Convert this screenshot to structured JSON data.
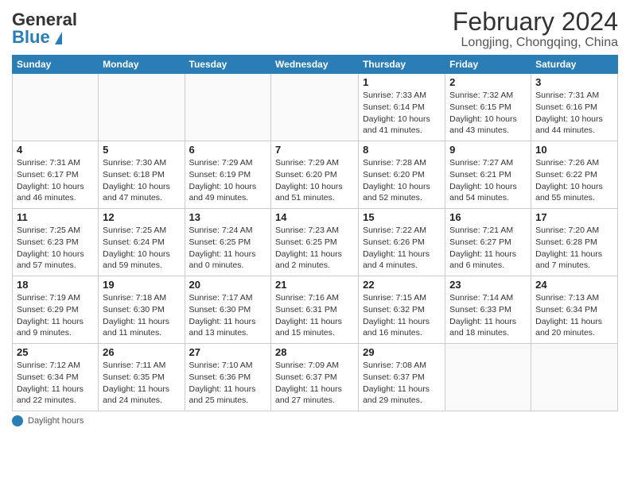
{
  "header": {
    "logo_text_general": "General",
    "logo_text_blue": "Blue",
    "month_title": "February 2024",
    "location": "Longjing, Chongqing, China"
  },
  "days_of_week": [
    "Sunday",
    "Monday",
    "Tuesday",
    "Wednesday",
    "Thursday",
    "Friday",
    "Saturday"
  ],
  "footer": {
    "daylight_label": "Daylight hours"
  },
  "weeks": [
    [
      {
        "day": "",
        "info": ""
      },
      {
        "day": "",
        "info": ""
      },
      {
        "day": "",
        "info": ""
      },
      {
        "day": "",
        "info": ""
      },
      {
        "day": "1",
        "info": "Sunrise: 7:33 AM\nSunset: 6:14 PM\nDaylight: 10 hours\nand 41 minutes."
      },
      {
        "day": "2",
        "info": "Sunrise: 7:32 AM\nSunset: 6:15 PM\nDaylight: 10 hours\nand 43 minutes."
      },
      {
        "day": "3",
        "info": "Sunrise: 7:31 AM\nSunset: 6:16 PM\nDaylight: 10 hours\nand 44 minutes."
      }
    ],
    [
      {
        "day": "4",
        "info": "Sunrise: 7:31 AM\nSunset: 6:17 PM\nDaylight: 10 hours\nand 46 minutes."
      },
      {
        "day": "5",
        "info": "Sunrise: 7:30 AM\nSunset: 6:18 PM\nDaylight: 10 hours\nand 47 minutes."
      },
      {
        "day": "6",
        "info": "Sunrise: 7:29 AM\nSunset: 6:19 PM\nDaylight: 10 hours\nand 49 minutes."
      },
      {
        "day": "7",
        "info": "Sunrise: 7:29 AM\nSunset: 6:20 PM\nDaylight: 10 hours\nand 51 minutes."
      },
      {
        "day": "8",
        "info": "Sunrise: 7:28 AM\nSunset: 6:20 PM\nDaylight: 10 hours\nand 52 minutes."
      },
      {
        "day": "9",
        "info": "Sunrise: 7:27 AM\nSunset: 6:21 PM\nDaylight: 10 hours\nand 54 minutes."
      },
      {
        "day": "10",
        "info": "Sunrise: 7:26 AM\nSunset: 6:22 PM\nDaylight: 10 hours\nand 55 minutes."
      }
    ],
    [
      {
        "day": "11",
        "info": "Sunrise: 7:25 AM\nSunset: 6:23 PM\nDaylight: 10 hours\nand 57 minutes."
      },
      {
        "day": "12",
        "info": "Sunrise: 7:25 AM\nSunset: 6:24 PM\nDaylight: 10 hours\nand 59 minutes."
      },
      {
        "day": "13",
        "info": "Sunrise: 7:24 AM\nSunset: 6:25 PM\nDaylight: 11 hours\nand 0 minutes."
      },
      {
        "day": "14",
        "info": "Sunrise: 7:23 AM\nSunset: 6:25 PM\nDaylight: 11 hours\nand 2 minutes."
      },
      {
        "day": "15",
        "info": "Sunrise: 7:22 AM\nSunset: 6:26 PM\nDaylight: 11 hours\nand 4 minutes."
      },
      {
        "day": "16",
        "info": "Sunrise: 7:21 AM\nSunset: 6:27 PM\nDaylight: 11 hours\nand 6 minutes."
      },
      {
        "day": "17",
        "info": "Sunrise: 7:20 AM\nSunset: 6:28 PM\nDaylight: 11 hours\nand 7 minutes."
      }
    ],
    [
      {
        "day": "18",
        "info": "Sunrise: 7:19 AM\nSunset: 6:29 PM\nDaylight: 11 hours\nand 9 minutes."
      },
      {
        "day": "19",
        "info": "Sunrise: 7:18 AM\nSunset: 6:30 PM\nDaylight: 11 hours\nand 11 minutes."
      },
      {
        "day": "20",
        "info": "Sunrise: 7:17 AM\nSunset: 6:30 PM\nDaylight: 11 hours\nand 13 minutes."
      },
      {
        "day": "21",
        "info": "Sunrise: 7:16 AM\nSunset: 6:31 PM\nDaylight: 11 hours\nand 15 minutes."
      },
      {
        "day": "22",
        "info": "Sunrise: 7:15 AM\nSunset: 6:32 PM\nDaylight: 11 hours\nand 16 minutes."
      },
      {
        "day": "23",
        "info": "Sunrise: 7:14 AM\nSunset: 6:33 PM\nDaylight: 11 hours\nand 18 minutes."
      },
      {
        "day": "24",
        "info": "Sunrise: 7:13 AM\nSunset: 6:34 PM\nDaylight: 11 hours\nand 20 minutes."
      }
    ],
    [
      {
        "day": "25",
        "info": "Sunrise: 7:12 AM\nSunset: 6:34 PM\nDaylight: 11 hours\nand 22 minutes."
      },
      {
        "day": "26",
        "info": "Sunrise: 7:11 AM\nSunset: 6:35 PM\nDaylight: 11 hours\nand 24 minutes."
      },
      {
        "day": "27",
        "info": "Sunrise: 7:10 AM\nSunset: 6:36 PM\nDaylight: 11 hours\nand 25 minutes."
      },
      {
        "day": "28",
        "info": "Sunrise: 7:09 AM\nSunset: 6:37 PM\nDaylight: 11 hours\nand 27 minutes."
      },
      {
        "day": "29",
        "info": "Sunrise: 7:08 AM\nSunset: 6:37 PM\nDaylight: 11 hours\nand 29 minutes."
      },
      {
        "day": "",
        "info": ""
      },
      {
        "day": "",
        "info": ""
      }
    ]
  ]
}
